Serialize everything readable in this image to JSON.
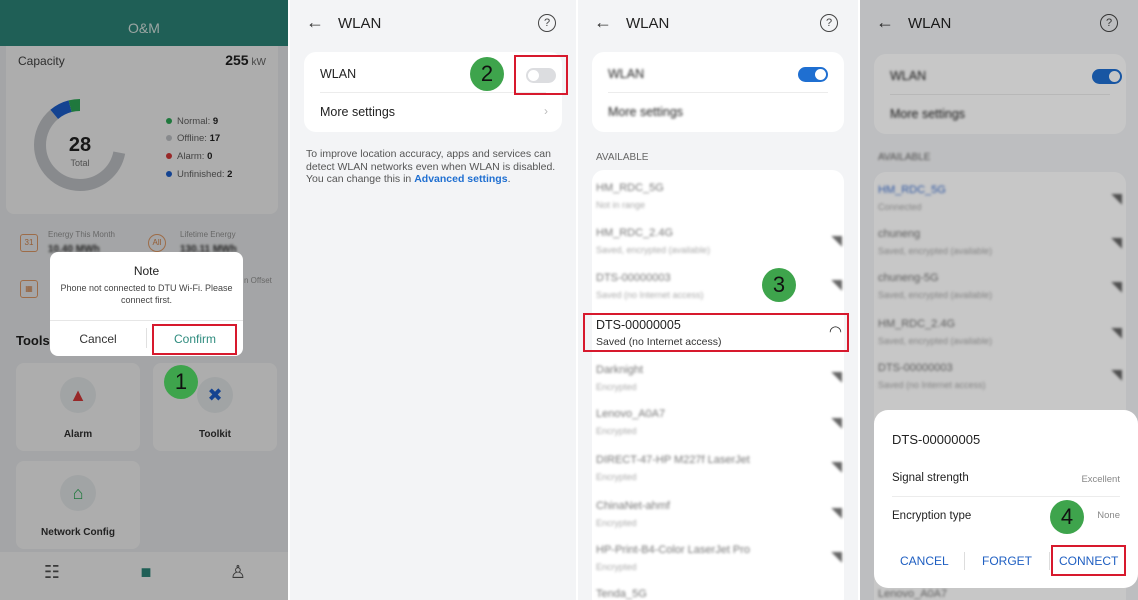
{
  "panel1": {
    "header_title": "O&M",
    "capacity": {
      "label": "Capacity",
      "value": "255",
      "unit": "kW"
    },
    "donut": {
      "total": "28",
      "total_label": "Total",
      "segments": [
        {
          "name": "Normal",
          "count": 9,
          "color": "#2fb25a"
        },
        {
          "name": "Offline",
          "count": 17,
          "color": "#c9ccd0"
        },
        {
          "name": "Alarm",
          "count": 0,
          "color": "#e03b3b"
        },
        {
          "name": "Unfinished",
          "count": 2,
          "color": "#1e63d6"
        }
      ],
      "legend": [
        {
          "label": "Normal: ",
          "value": "9",
          "color": "#2fb25a"
        },
        {
          "label": "Offline: ",
          "value": "17",
          "color": "#c9ccd0"
        },
        {
          "label": "Alarm: ",
          "value": "0",
          "color": "#e03b3b"
        },
        {
          "label": "Unfinished: ",
          "value": "2",
          "color": "#1e63d6"
        }
      ]
    },
    "stats": {
      "energy_month_label": "Energy This Month",
      "energy_month_value": "10.40 MWh",
      "lifetime_label": "Lifetime Energy",
      "lifetime_value": "130.11 MWh",
      "offset_label": "n Offset",
      "calendar_icon_text": "31",
      "all_icon_text": "All"
    },
    "dialog": {
      "title": "Note",
      "message": "Phone not connected to DTU Wi-Fi. Please connect first.",
      "cancel": "Cancel",
      "confirm": "Confirm"
    },
    "tools_title": "Tools",
    "tools": [
      {
        "label": "Alarm",
        "icon": "alarm-icon"
      },
      {
        "label": "Toolkit",
        "icon": "toolkit-icon"
      },
      {
        "label": "Network Config",
        "icon": "network-config-icon"
      }
    ],
    "step": "1"
  },
  "panel2": {
    "title": "WLAN",
    "wlan_label": "WLAN",
    "more_settings": "More settings",
    "info_text": "To improve location accuracy, apps and services can detect WLAN networks even when WLAN is disabled. You can change this in ",
    "info_link": "Advanced settings",
    "info_end": ".",
    "toggle_on": false,
    "step": "2"
  },
  "panel3": {
    "title": "WLAN",
    "wlan_label": "WLAN",
    "more_settings": "More settings",
    "available_label": "AVAILABLE",
    "networks": [
      {
        "name": "HM_RDC_5G",
        "status": "Not in range"
      },
      {
        "name": "HM_RDC_2.4G",
        "status": "Saved, encrypted (available)"
      },
      {
        "name": "DTS-00000003",
        "status": "Saved (no Internet access)"
      },
      {
        "name": "DTS-00000005",
        "status": "Saved (no Internet access)"
      },
      {
        "name": "Darknight",
        "status": "Encrypted"
      },
      {
        "name": "Lenovo_A0A7",
        "status": "Encrypted"
      },
      {
        "name": "DIRECT-47-HP M227f LaserJet",
        "status": "Encrypted"
      },
      {
        "name": "ChinaNet-ahmf",
        "status": "Encrypted"
      },
      {
        "name": "HP-Print-B4-Color LaserJet Pro",
        "status": "Encrypted"
      },
      {
        "name": "Tenda_5G",
        "status": ""
      }
    ],
    "toggle_on": true,
    "step": "3"
  },
  "panel4": {
    "title": "WLAN",
    "wlan_label": "WLAN",
    "more_settings": "More settings",
    "available_label": "AVAILABLE",
    "networks": [
      {
        "name": "HM_RDC_5G",
        "status": "Connected"
      },
      {
        "name": "chuneng",
        "status": "Saved, encrypted (available)"
      },
      {
        "name": "chuneng-5G",
        "status": "Saved, encrypted (available)"
      },
      {
        "name": "HM_RDC_2.4G",
        "status": "Saved, encrypted (available)"
      },
      {
        "name": "DTS-00000003",
        "status": "Saved (no Internet access)"
      }
    ],
    "footer_network": "Lenovo_A0A7",
    "toggle_on": true,
    "sheet": {
      "title": "DTS-00000005",
      "signal_label": "Signal strength",
      "signal_value": "Excellent",
      "encryption_label": "Encryption type",
      "encryption_value": "None",
      "cancel": "CANCEL",
      "forget": "FORGET",
      "connect": "CONNECT"
    },
    "step": "4"
  },
  "colors": {
    "brand_teal": "#2f8c7f",
    "accent_blue": "#1f6fd1",
    "highlight_red": "#d7192d",
    "step_green": "#3ea44c"
  }
}
